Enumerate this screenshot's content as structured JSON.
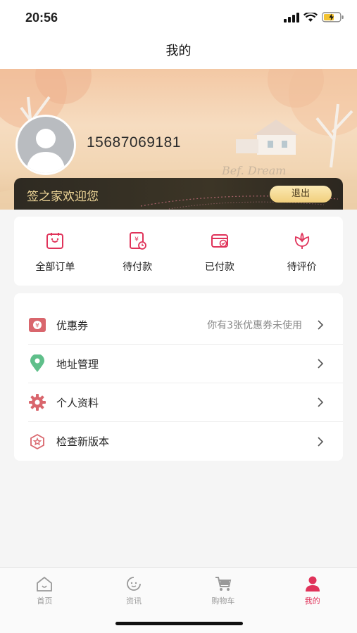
{
  "status_bar": {
    "time": "20:56"
  },
  "nav": {
    "title": "我的"
  },
  "profile": {
    "phone": "15687069181",
    "welcome_text": "签之家欢迎您",
    "logout_label": "退出"
  },
  "orders": [
    {
      "label": "全部订单",
      "icon": "all-orders-icon"
    },
    {
      "label": "待付款",
      "icon": "pending-payment-icon"
    },
    {
      "label": "已付款",
      "icon": "paid-icon"
    },
    {
      "label": "待评价",
      "icon": "pending-review-icon"
    }
  ],
  "menu": [
    {
      "label": "优惠券",
      "hint": "你有3张优惠券未使用",
      "icon": "coupon-icon"
    },
    {
      "label": "地址管理",
      "hint": "",
      "icon": "location-icon"
    },
    {
      "label": "个人资料",
      "hint": "",
      "icon": "gear-icon"
    },
    {
      "label": "检查新版本",
      "hint": "",
      "icon": "version-icon"
    }
  ],
  "tabs": [
    {
      "label": "首页",
      "icon": "home-icon",
      "active": false
    },
    {
      "label": "资讯",
      "icon": "news-icon",
      "active": false
    },
    {
      "label": "购物车",
      "icon": "cart-icon",
      "active": false
    },
    {
      "label": "我的",
      "icon": "profile-icon",
      "active": true
    }
  ],
  "colors": {
    "accent": "#e0335a",
    "icon_pink": "#e0335a",
    "location_green": "#5fbf8a",
    "gold": "#f1cf7c"
  }
}
